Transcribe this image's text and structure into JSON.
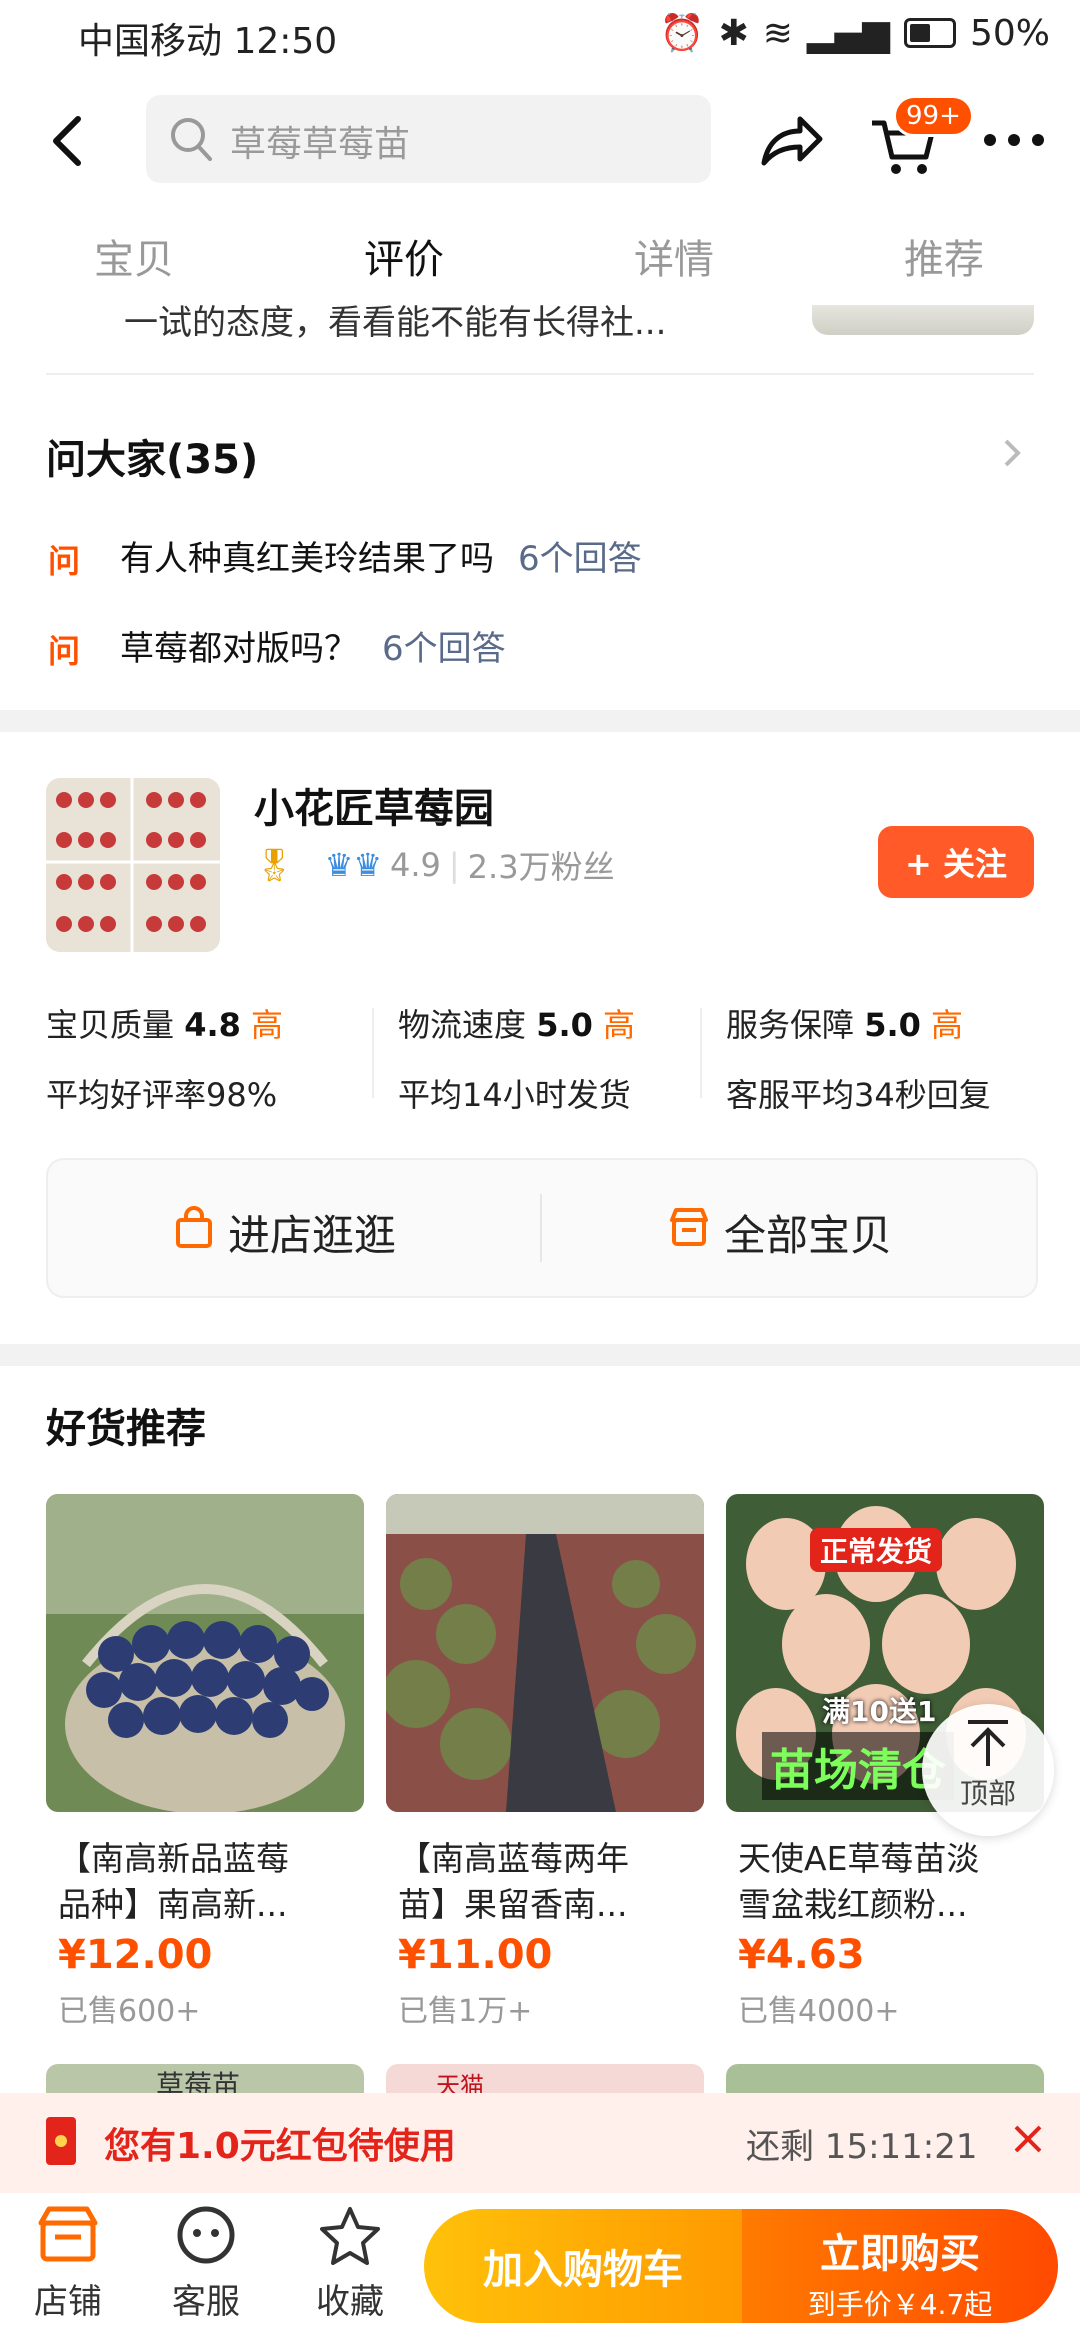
{
  "status_bar": {
    "carrier_time": "中国移动 12:50",
    "battery": "50%"
  },
  "header": {
    "search_placeholder": "草莓草莓苗",
    "cart_badge": "99+"
  },
  "tabs": [
    "宝贝",
    "评价",
    "详情",
    "推荐"
  ],
  "review_snippet": "一试的态度，看看能不能有长得社...",
  "qa": {
    "title": "问大家(35)",
    "icon_label": "问",
    "items": [
      {
        "question": "有人种真红美玲结果了吗",
        "answers": "6个回答"
      },
      {
        "question": "草莓都对版吗？",
        "answers": "6个回答"
      }
    ]
  },
  "shop": {
    "name": "小花匠草莓园",
    "score": "4.9",
    "fans": "2.3万粉丝",
    "follow_label": "+ 关注",
    "metrics": [
      {
        "label": "宝贝质量",
        "value": "4.8",
        "level": "高",
        "sub": "平均好评率98%"
      },
      {
        "label": "物流速度",
        "value": "5.0",
        "level": "高",
        "sub": "平均14小时发货"
      },
      {
        "label": "服务保障",
        "value": "5.0",
        "level": "高",
        "sub": "客服平均34秒回复"
      }
    ],
    "enter_label": "进店逛逛",
    "all_items_label": "全部宝贝"
  },
  "recommend": {
    "title": "好货推荐",
    "products": [
      {
        "title_line1": "【南高新品蓝莓",
        "title_line2": "品种】南高新...",
        "price": "¥12.00",
        "sold": "已售600+"
      },
      {
        "title_line1": "【南高蓝莓两年",
        "title_line2": "苗】果留香南...",
        "price": "¥11.00",
        "sold": "已售1万+"
      },
      {
        "title_line1": "天使AE草莓苗淡",
        "title_line2": "雪盆栽红颜粉...",
        "price": "¥4.63",
        "sold": "已售4000+",
        "tag1": "正常发货",
        "tag2": "满10送1",
        "tag3": "苗场清仓"
      }
    ],
    "back_top_label": "顶部",
    "partial_tags": [
      "草莓苗",
      "天猫"
    ]
  },
  "coupon": {
    "text": "您有1.0元红包待使用",
    "countdown": "还剩 15:11:21"
  },
  "bottom_bar": {
    "shop_label": "店铺",
    "service_label": "客服",
    "fav_label": "收藏",
    "cart_label": "加入购物车",
    "buy_label": "立即购买",
    "buy_sub": "到手价￥4.7起"
  },
  "colors": {
    "accent": "#ff5000",
    "brand_orange": "#ff6a00"
  }
}
